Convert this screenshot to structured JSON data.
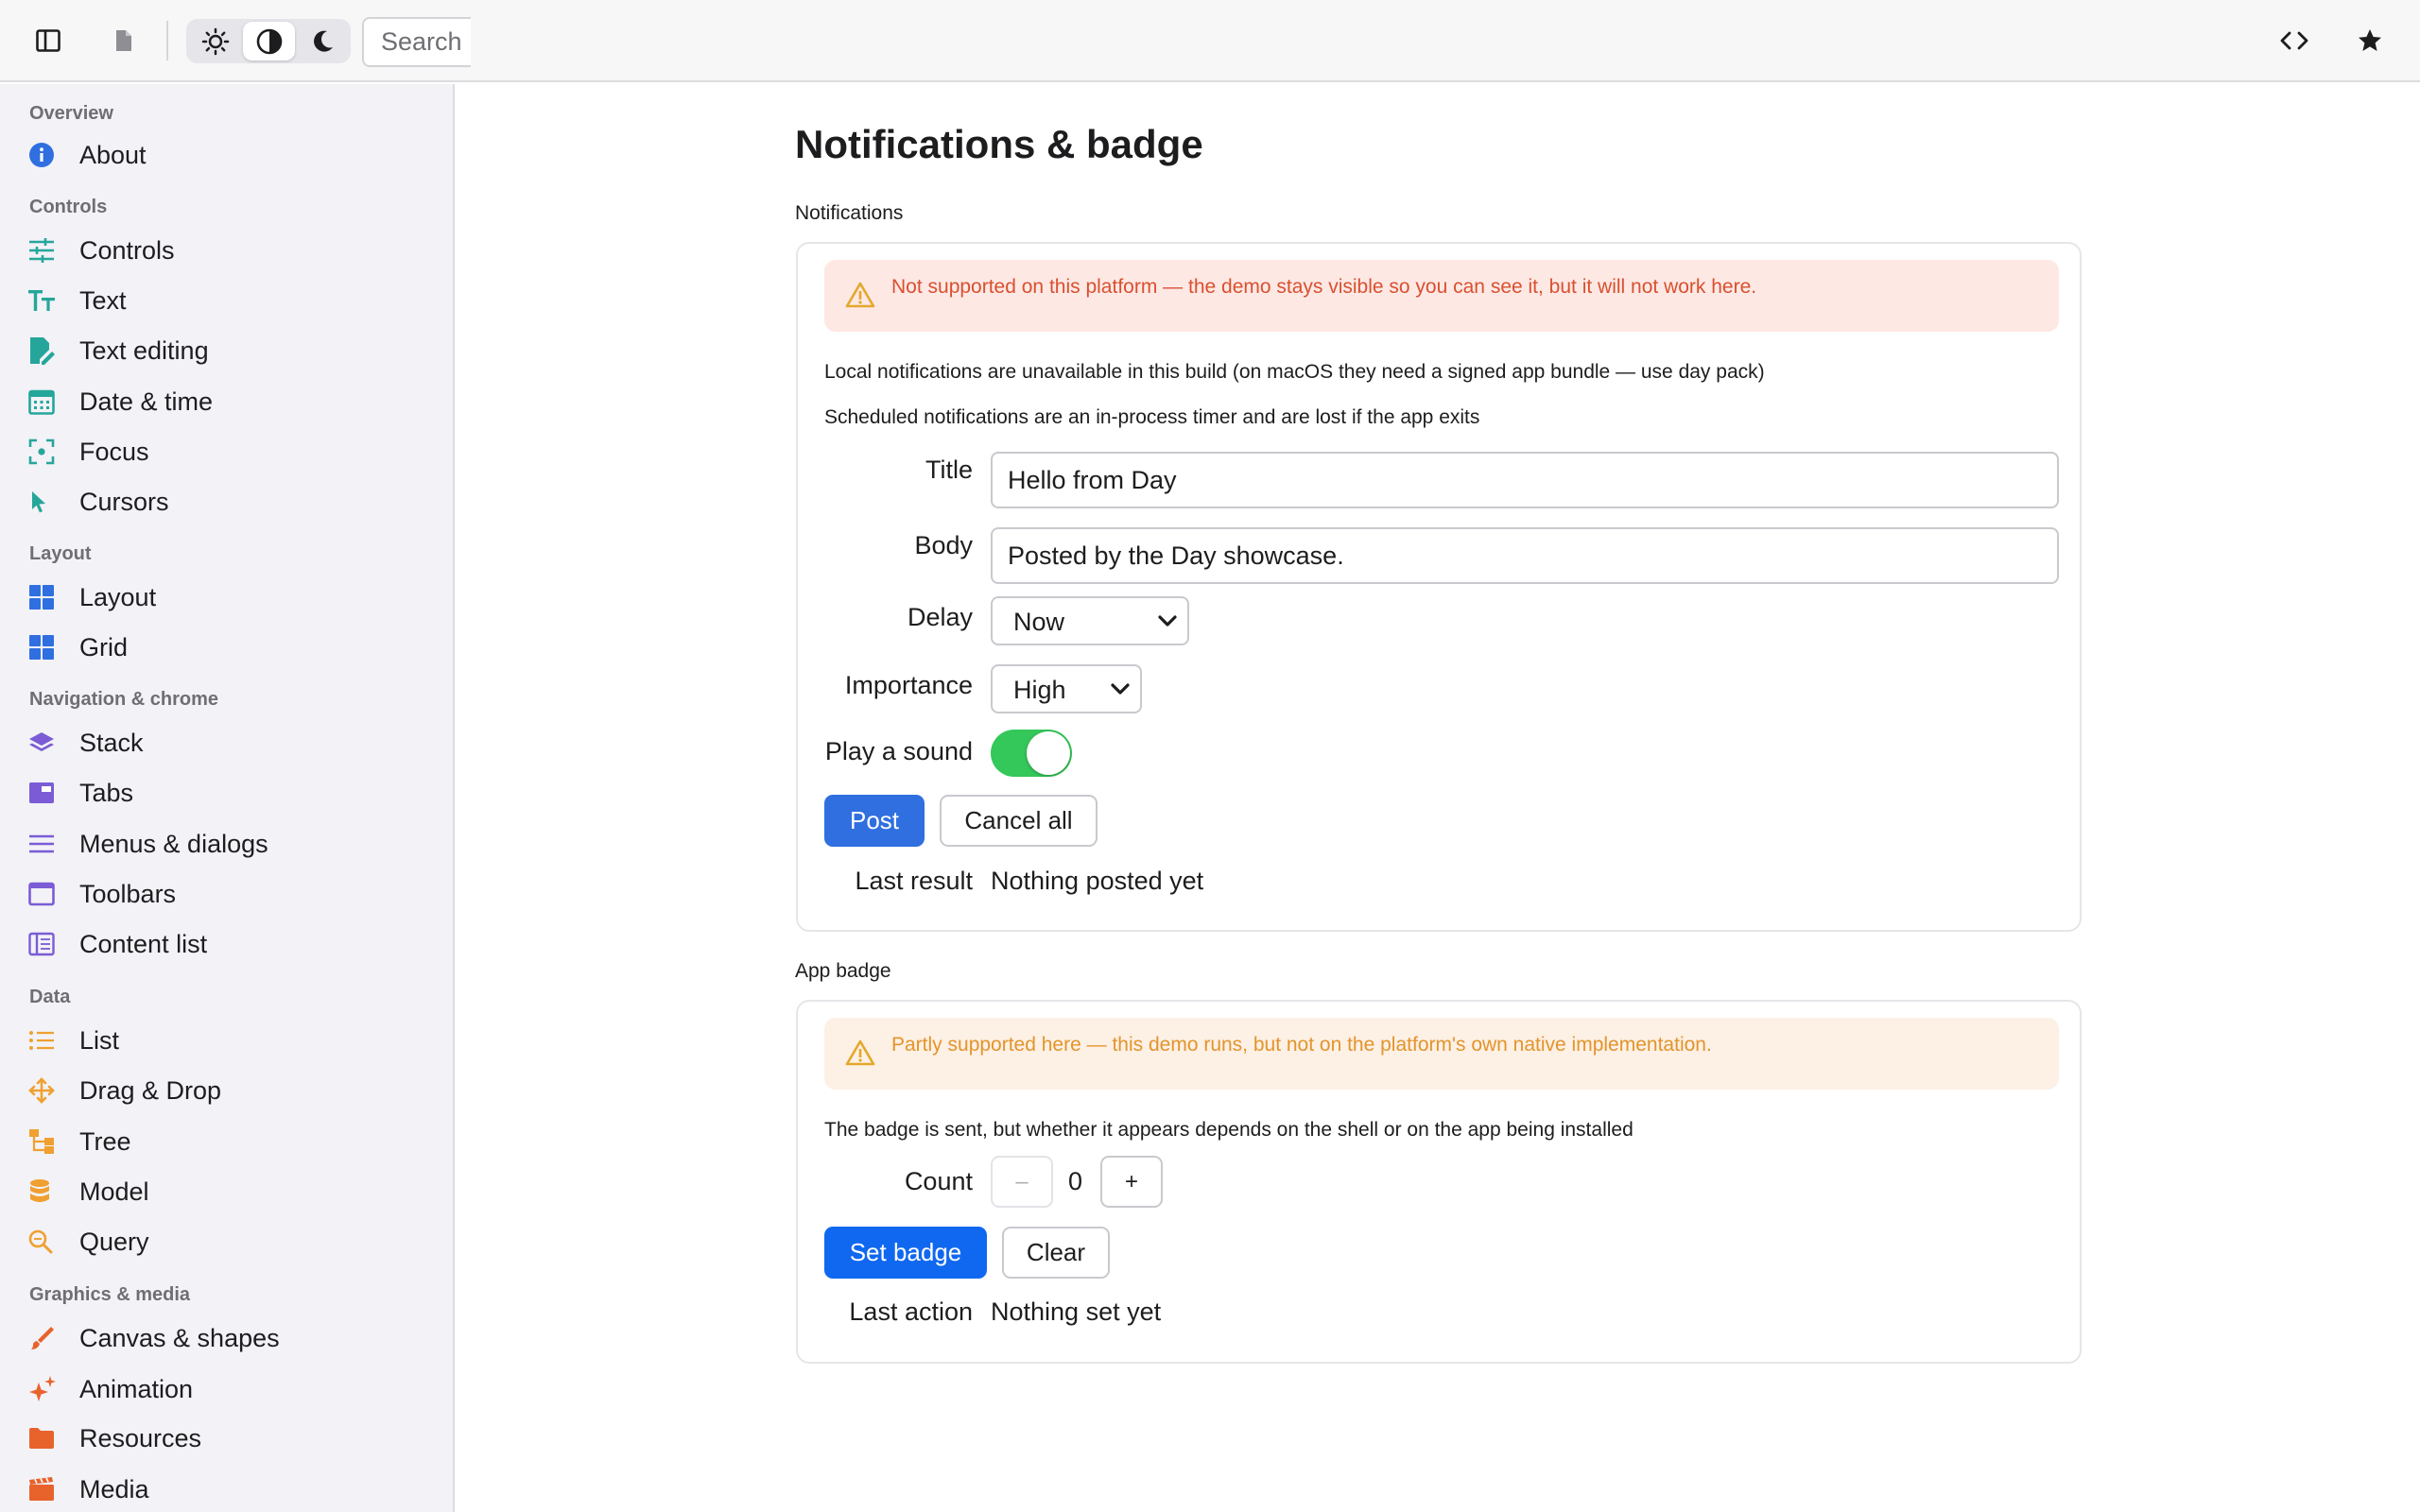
{
  "toolbar": {
    "search_placeholder": "Search",
    "sidebar_toggle_icon": "sidebar-icon",
    "document_icon": "document-icon",
    "theme_options": [
      "light",
      "auto",
      "dark"
    ],
    "theme_selected": "auto",
    "code_icon": "code-icon",
    "favorite_icon": "star-icon"
  },
  "sidebar": {
    "sections": [
      {
        "title": "Overview",
        "items": [
          {
            "label": "About",
            "icon": "info-icon",
            "color": "#2f6fe0"
          }
        ]
      },
      {
        "title": "Controls",
        "items": [
          {
            "label": "Controls",
            "icon": "sliders-icon",
            "color": "#26a69a"
          },
          {
            "label": "Text",
            "icon": "text-size-icon",
            "color": "#26a69a"
          },
          {
            "label": "Text editing",
            "icon": "edit-document-icon",
            "color": "#26a69a"
          },
          {
            "label": "Date & time",
            "icon": "calendar-icon",
            "color": "#26a69a"
          },
          {
            "label": "Focus",
            "icon": "focus-icon",
            "color": "#26a69a"
          },
          {
            "label": "Cursors",
            "icon": "cursor-icon",
            "color": "#26a69a"
          }
        ]
      },
      {
        "title": "Layout",
        "items": [
          {
            "label": "Layout",
            "icon": "layout-grid-icon",
            "color": "#2f6fe0"
          },
          {
            "label": "Grid",
            "icon": "grid-icon",
            "color": "#2f6fe0"
          }
        ]
      },
      {
        "title": "Navigation & chrome",
        "items": [
          {
            "label": "Stack",
            "icon": "layers-icon",
            "color": "#7b5cd6"
          },
          {
            "label": "Tabs",
            "icon": "tabs-icon",
            "color": "#7b5cd6"
          },
          {
            "label": "Menus & dialogs",
            "icon": "menu-icon",
            "color": "#7b5cd6"
          },
          {
            "label": "Toolbars",
            "icon": "window-icon",
            "color": "#7b5cd6"
          },
          {
            "label": "Content list",
            "icon": "columns-icon",
            "color": "#7b5cd6"
          }
        ]
      },
      {
        "title": "Data",
        "items": [
          {
            "label": "List",
            "icon": "list-icon",
            "color": "#f0a030"
          },
          {
            "label": "Drag & Drop",
            "icon": "move-icon",
            "color": "#f0a030"
          },
          {
            "label": "Tree",
            "icon": "tree-icon",
            "color": "#f0a030"
          },
          {
            "label": "Model",
            "icon": "database-icon",
            "color": "#f0a030"
          },
          {
            "label": "Query",
            "icon": "search-icon",
            "color": "#f0a030"
          }
        ]
      },
      {
        "title": "Graphics & media",
        "items": [
          {
            "label": "Canvas & shapes",
            "icon": "brush-icon",
            "color": "#e8622c"
          },
          {
            "label": "Animation",
            "icon": "sparkles-icon",
            "color": "#e8622c"
          },
          {
            "label": "Resources",
            "icon": "folder-icon",
            "color": "#e8622c"
          },
          {
            "label": "Media",
            "icon": "film-icon",
            "color": "#e8622c"
          }
        ]
      }
    ]
  },
  "main": {
    "title": "Notifications & badge",
    "notifications": {
      "label": "Notifications",
      "alert": "Not supported on this platform — the demo stays visible so you can see it, but it will not work here.",
      "note1": "Local notifications are unavailable in this build (on macOS they need a signed app bundle — use day pack)",
      "note2": "Scheduled notifications are an in-process timer and are lost if the app exits",
      "title_label": "Title",
      "title_value": "Hello from Day",
      "body_label": "Body",
      "body_value": "Posted by the Day showcase.",
      "delay_label": "Delay",
      "delay_value": "Now",
      "importance_label": "Importance",
      "importance_value": "High",
      "sound_label": "Play a sound",
      "sound_on": true,
      "post_label": "Post",
      "cancel_label": "Cancel all",
      "result_label": "Last result",
      "result_value": "Nothing posted yet"
    },
    "badge": {
      "label": "App badge",
      "alert": "Partly supported here — this demo runs, but not on the platform's own native implementation.",
      "note": "The badge is sent, but whether it appears depends on the shell or on the app being installed",
      "count_label": "Count",
      "count_value": "0",
      "minus_label": "–",
      "plus_label": "+",
      "set_label": "Set badge",
      "clear_label": "Clear",
      "action_label": "Last action",
      "action_value": "Nothing set yet"
    }
  },
  "colors": {
    "accent": "#2f6fe0",
    "accent_bright": "#1068f0",
    "toggle_on": "#34c759",
    "alert_red_bg": "#fde8e4",
    "alert_red_text": "#d9502f",
    "alert_orange_bg": "#fdf0e4",
    "alert_orange_text": "#e3942c"
  }
}
